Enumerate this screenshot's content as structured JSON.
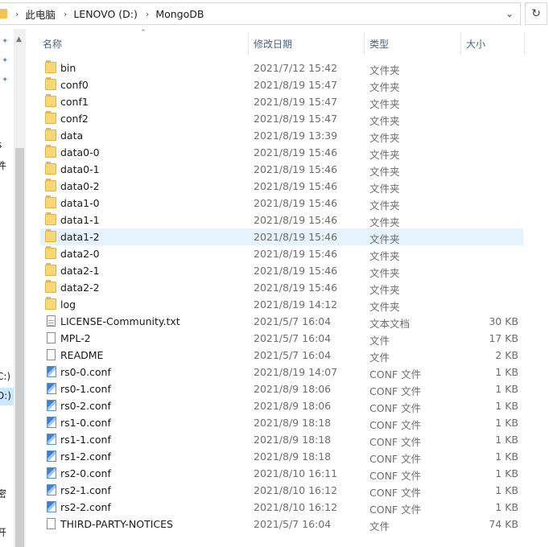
{
  "address": {
    "crumbs": [
      "此电脑",
      "LENOVO (D:)",
      "MongoDB"
    ]
  },
  "nav": {
    "fragments": [
      "s",
      "件",
      "C:)",
      "D:)",
      "密",
      "开"
    ]
  },
  "columns": {
    "name": "名称",
    "date": "修改日期",
    "type": "类型",
    "size": "大小"
  },
  "files": [
    {
      "name": "bin",
      "date": "2021/7/12 15:42",
      "type": "文件夹",
      "size": "",
      "icon": "folder"
    },
    {
      "name": "conf0",
      "date": "2021/8/19 15:47",
      "type": "文件夹",
      "size": "",
      "icon": "folder"
    },
    {
      "name": "conf1",
      "date": "2021/8/19 15:47",
      "type": "文件夹",
      "size": "",
      "icon": "folder"
    },
    {
      "name": "conf2",
      "date": "2021/8/19 15:47",
      "type": "文件夹",
      "size": "",
      "icon": "folder"
    },
    {
      "name": "data",
      "date": "2021/8/19 13:39",
      "type": "文件夹",
      "size": "",
      "icon": "folder"
    },
    {
      "name": "data0-0",
      "date": "2021/8/19 15:46",
      "type": "文件夹",
      "size": "",
      "icon": "folder"
    },
    {
      "name": "data0-1",
      "date": "2021/8/19 15:46",
      "type": "文件夹",
      "size": "",
      "icon": "folder"
    },
    {
      "name": "data0-2",
      "date": "2021/8/19 15:46",
      "type": "文件夹",
      "size": "",
      "icon": "folder"
    },
    {
      "name": "data1-0",
      "date": "2021/8/19 15:46",
      "type": "文件夹",
      "size": "",
      "icon": "folder"
    },
    {
      "name": "data1-1",
      "date": "2021/8/19 15:46",
      "type": "文件夹",
      "size": "",
      "icon": "folder"
    },
    {
      "name": "data1-2",
      "date": "2021/8/19 15:46",
      "type": "文件夹",
      "size": "",
      "icon": "folder",
      "selected": true
    },
    {
      "name": "data2-0",
      "date": "2021/8/19 15:46",
      "type": "文件夹",
      "size": "",
      "icon": "folder"
    },
    {
      "name": "data2-1",
      "date": "2021/8/19 15:46",
      "type": "文件夹",
      "size": "",
      "icon": "folder"
    },
    {
      "name": "data2-2",
      "date": "2021/8/19 15:46",
      "type": "文件夹",
      "size": "",
      "icon": "folder"
    },
    {
      "name": "log",
      "date": "2021/8/19 14:12",
      "type": "文件夹",
      "size": "",
      "icon": "folder"
    },
    {
      "name": "LICENSE-Community.txt",
      "date": "2021/5/7 16:04",
      "type": "文本文档",
      "size": "30 KB",
      "icon": "text-file"
    },
    {
      "name": "MPL-2",
      "date": "2021/5/7 16:04",
      "type": "文件",
      "size": "17 KB",
      "icon": "file"
    },
    {
      "name": "README",
      "date": "2021/5/7 16:04",
      "type": "文件",
      "size": "2 KB",
      "icon": "file"
    },
    {
      "name": "rs0-0.conf",
      "date": "2021/8/19 14:07",
      "type": "CONF 文件",
      "size": "1 KB",
      "icon": "conf-file"
    },
    {
      "name": "rs0-1.conf",
      "date": "2021/8/9 18:06",
      "type": "CONF 文件",
      "size": "1 KB",
      "icon": "conf-file"
    },
    {
      "name": "rs0-2.conf",
      "date": "2021/8/9 18:06",
      "type": "CONF 文件",
      "size": "1 KB",
      "icon": "conf-file"
    },
    {
      "name": "rs1-0.conf",
      "date": "2021/8/9 18:18",
      "type": "CONF 文件",
      "size": "1 KB",
      "icon": "conf-file"
    },
    {
      "name": "rs1-1.conf",
      "date": "2021/8/9 18:18",
      "type": "CONF 文件",
      "size": "1 KB",
      "icon": "conf-file"
    },
    {
      "name": "rs1-2.conf",
      "date": "2021/8/9 18:18",
      "type": "CONF 文件",
      "size": "1 KB",
      "icon": "conf-file"
    },
    {
      "name": "rs2-0.conf",
      "date": "2021/8/10 16:11",
      "type": "CONF 文件",
      "size": "1 KB",
      "icon": "conf-file"
    },
    {
      "name": "rs2-1.conf",
      "date": "2021/8/10 16:12",
      "type": "CONF 文件",
      "size": "1 KB",
      "icon": "conf-file"
    },
    {
      "name": "rs2-2.conf",
      "date": "2021/8/10 16:12",
      "type": "CONF 文件",
      "size": "1 KB",
      "icon": "conf-file"
    },
    {
      "name": "THIRD-PARTY-NOTICES",
      "date": "2021/5/7 16:04",
      "type": "文件",
      "size": "74 KB",
      "icon": "file"
    }
  ],
  "colors": {
    "selection": "#e5f3ff",
    "header_text": "#4d6182",
    "folder": "#f8d775"
  }
}
